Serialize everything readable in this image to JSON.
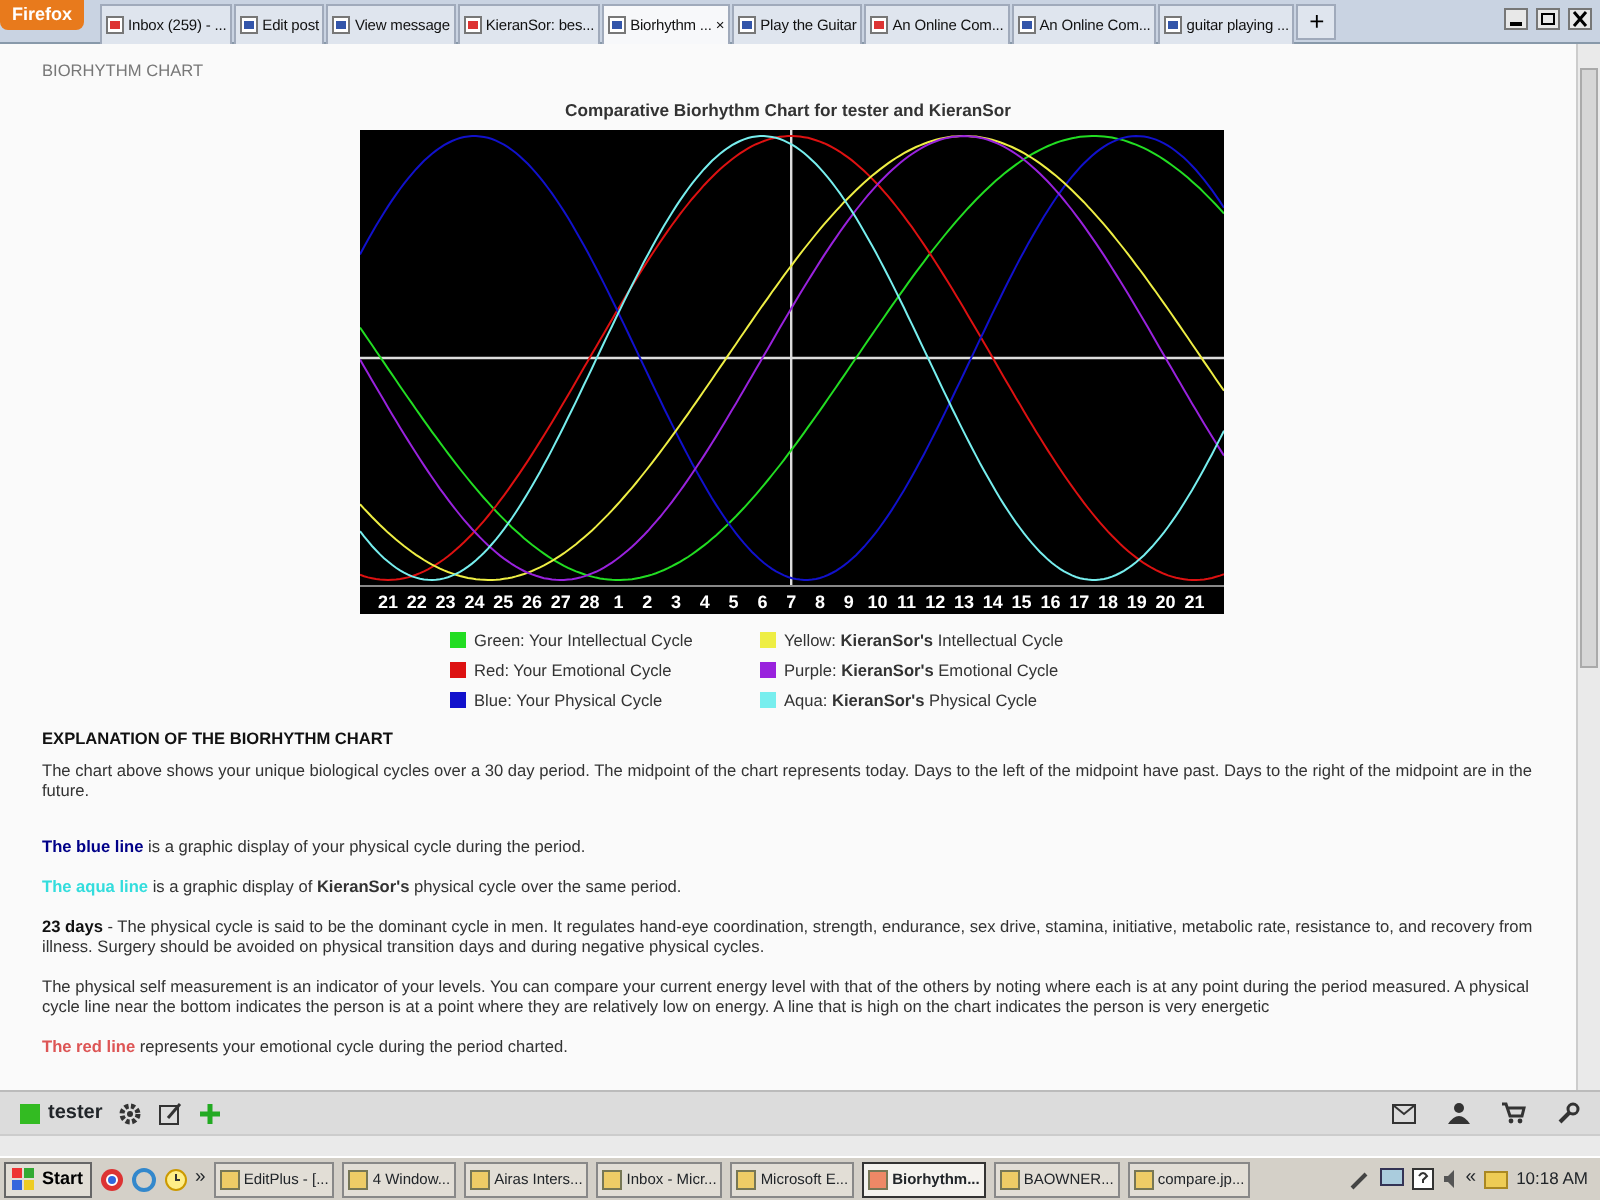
{
  "browser": {
    "menu_button": "Firefox",
    "close_label": "×",
    "new_tab": "+",
    "tabs": [
      {
        "label": "Inbox (259) - ...",
        "selected": false
      },
      {
        "label": "Edit post",
        "selected": false
      },
      {
        "label": "View message",
        "selected": false
      },
      {
        "label": "KieranSor: bes...",
        "selected": false
      },
      {
        "label": "Biorhythm ...",
        "selected": true
      },
      {
        "label": "Play the Guitar",
        "selected": false
      },
      {
        "label": "An Online Com...",
        "selected": false
      },
      {
        "label": "An Online Com...",
        "selected": false
      },
      {
        "label": "guitar playing ...",
        "selected": false
      }
    ]
  },
  "page": {
    "heading": "BIORHYTHM CHART",
    "chart": {
      "title": "Comparative Biorhythm Chart for tester and KieranSor",
      "day_labels": [
        "21",
        "22",
        "23",
        "24",
        "25",
        "26",
        "27",
        "28",
        "1",
        "2",
        "3",
        "4",
        "5",
        "6",
        "7",
        "8",
        "9",
        "10",
        "11",
        "12",
        "13",
        "14",
        "15",
        "16",
        "17",
        "18",
        "19",
        "20",
        "21"
      ]
    },
    "legend": [
      {
        "text": "Green: Your Intellectual Cycle",
        "color": "#22dd22"
      },
      {
        "text": "Red: Your Emotional Cycle",
        "color": "#dd1111"
      },
      {
        "text": "Blue: Your Physical Cycle",
        "color": "#1111cc"
      },
      {
        "text": "Yellow: **KieranSor's** Intellectual Cycle",
        "color": "#eeee44"
      },
      {
        "text": "Purple: **KieranSor's** Emotional Cycle",
        "color": "#9922dd"
      },
      {
        "text": "Aqua: **KieranSor's** Physical Cycle",
        "color": "#77eeee"
      }
    ],
    "explanation_heading": "EXPLANATION OF THE BIORHYTHM CHART",
    "paragraphs": [
      {
        "text": "The chart above shows your unique biological cycles over a 30 day period. The midpoint of the chart represents today. Days to the left of the midpoint have past. Days to the right of the midpoint are in the future."
      },
      {
        "lead": "The blue line",
        "color": "#000088",
        "text": "is a graphic display of your physical cycle during the period."
      },
      {
        "lead": "The aqua line",
        "color": "#33dddd",
        "text": "is a graphic display of **KieranSor's** physical cycle over the same period."
      },
      {
        "lead": "23 days",
        "text": "- The physical cycle is said to be the dominant cycle in men. It regulates hand-eye coordination, strength, endurance, sex drive, stamina, initiative, metabolic rate, resistance to, and recovery from illness. Surgery should be avoided on physical transition days and during negative physical cycles."
      },
      {
        "text": "The physical self measurement is an indicator of your levels. You can compare your current energy level with that of the others by noting where each is at any point during the period measured. A physical cycle line near the bottom indicates the person is at a point where they are relatively low on energy. A line that is high on the chart indicates the person is very energetic"
      },
      {
        "lead": "The red line",
        "color": "#dd5555",
        "text": "represents your emotional cycle during the period charted."
      }
    ]
  },
  "addon_bar": {
    "user": "tester"
  },
  "taskbar": {
    "start": "Start",
    "overflow": "»",
    "tray_overflow": "«",
    "clock": "10:18 AM",
    "tasks": [
      {
        "label": "EditPlus - [...",
        "selected": false
      },
      {
        "label": "4 Window...",
        "selected": false
      },
      {
        "label": "Airas Inters...",
        "selected": false
      },
      {
        "label": "Inbox - Micr...",
        "selected": false
      },
      {
        "label": "Microsoft E...",
        "selected": false
      },
      {
        "label": "Biorhythm...",
        "selected": true
      },
      {
        "label": "BAOWNER...",
        "selected": false
      },
      {
        "label": "compare.jp...",
        "selected": false
      }
    ]
  }
}
